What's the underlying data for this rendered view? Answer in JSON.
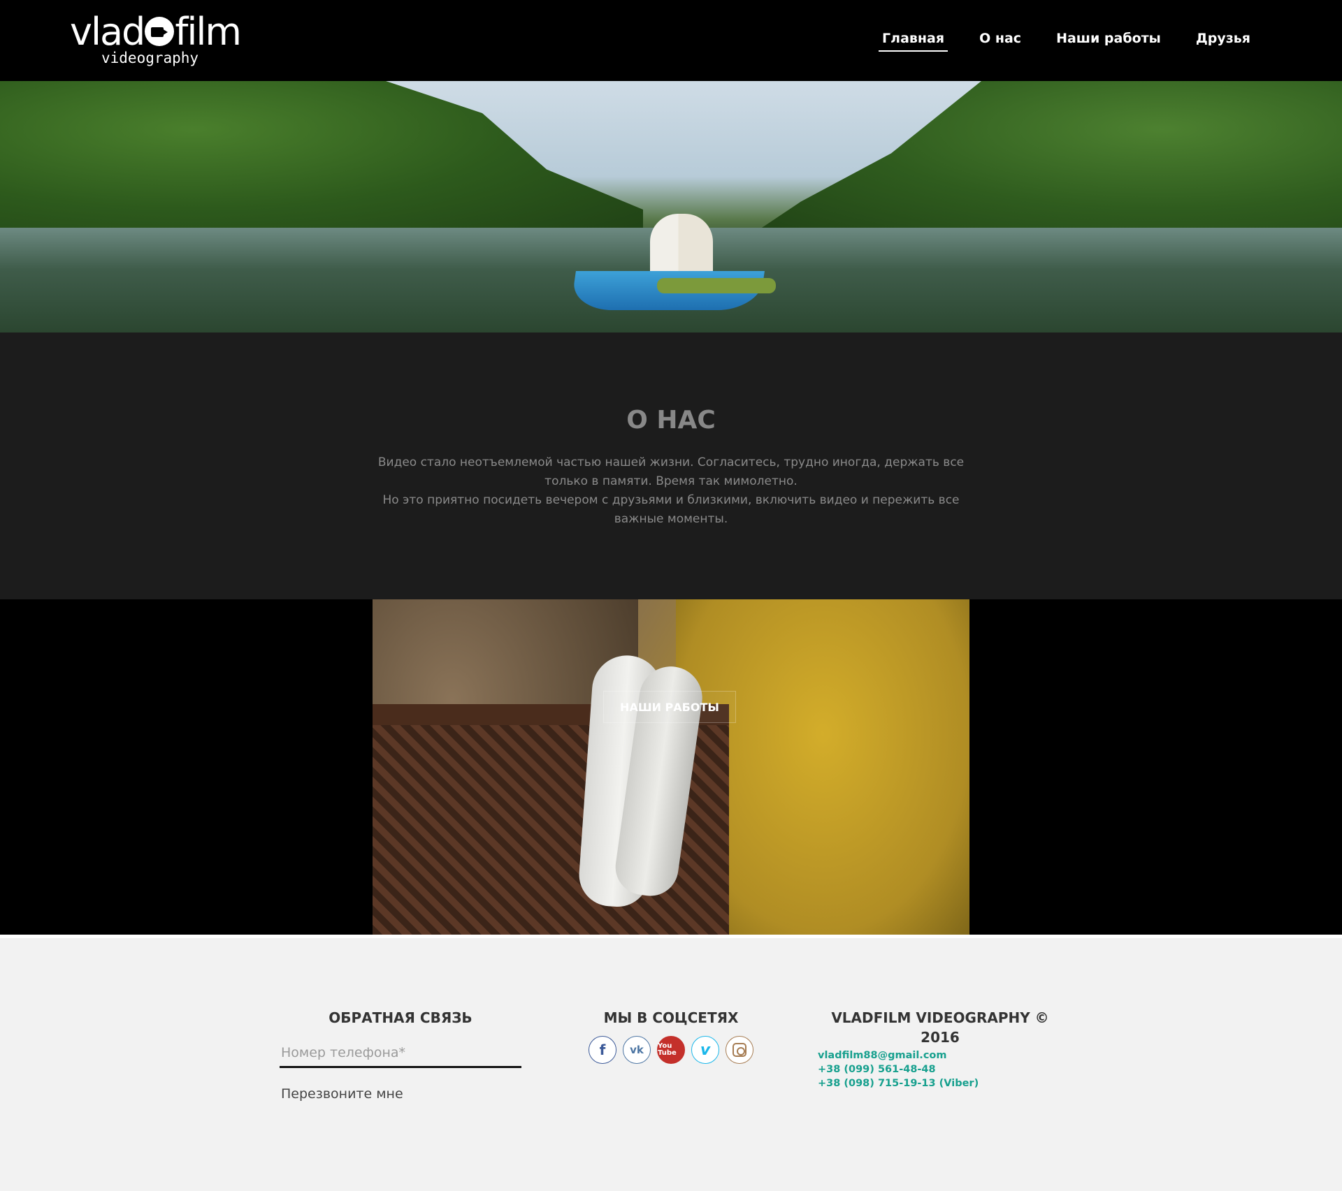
{
  "header": {
    "logo_main_left": "vlad",
    "logo_main_right": "film",
    "logo_sub": "videography",
    "nav": [
      {
        "label": "Главная",
        "active": true
      },
      {
        "label": "О нас",
        "active": false
      },
      {
        "label": "Наши работы",
        "active": false
      },
      {
        "label": "Друзья",
        "active": false
      }
    ]
  },
  "about": {
    "title": "О НАС",
    "text_1": "Видео стало неотъемлемой частью нашей жизни. Согласитесь, трудно иногда, держать все только в памяти. Время так мимолетно.",
    "text_2": "Но это приятно посидеть вечером с друзьями и близкими, включить видео и пережить все важные моменты."
  },
  "works": {
    "button_label": "Наши работы"
  },
  "footer": {
    "feedback": {
      "title": "Обратная связь",
      "phone_placeholder": "Номер телефона*",
      "callback_label": "Перезвоните мне"
    },
    "social": {
      "title": "Мы в соцсетях",
      "icons": [
        "facebook-icon",
        "vk-icon",
        "youtube-icon",
        "vimeo-icon",
        "instagram-icon"
      ],
      "icon_glyphs": {
        "fb": "f",
        "vk": "vk",
        "yt": "You Tube",
        "vm": "v"
      }
    },
    "contacts": {
      "title": "VLADFILM VIDEOGRAPHY © 2016",
      "email": "vladfilm88@gmail.com",
      "phone_1": "+38 (099) 561-48-48",
      "phone_2": "+38 (098) 715-19-13 (Viber)"
    }
  },
  "colors": {
    "header_bg": "#000000",
    "about_bg": "#1c1c1c",
    "footer_bg": "#f2f2f2",
    "contact_accent": "#17a08e"
  }
}
